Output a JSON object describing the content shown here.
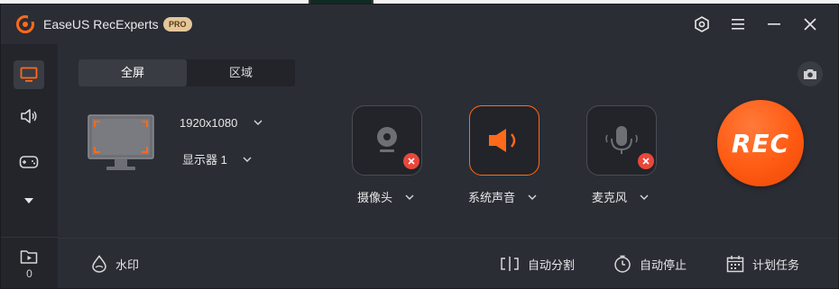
{
  "app": {
    "title": "EaseUS RecExperts",
    "badge": "PRO",
    "accent_color": "#ff6a1a",
    "rec_color": "#ff5a12"
  },
  "titlebar": {
    "buttons": [
      "settings-icon",
      "menu-icon",
      "minimize-icon",
      "close-icon"
    ]
  },
  "sidebar": {
    "items": [
      "screen-record-icon",
      "audio-record-icon",
      "game-record-icon",
      "more-dropdown-icon"
    ],
    "file_count": "0"
  },
  "capture": {
    "tabs": [
      "全屏",
      "区域"
    ],
    "active_tab": "全屏",
    "resolution": "1920x1080",
    "display": "显示器 1"
  },
  "sources": {
    "webcam": {
      "label": "摄像头",
      "enabled": false
    },
    "system_audio": {
      "label": "系统声音",
      "enabled": true
    },
    "microphone": {
      "label": "麦克风",
      "enabled": false
    }
  },
  "rec_button": {
    "label": "REC"
  },
  "bottom": {
    "watermark": "水印",
    "auto_split": "自动分割",
    "auto_stop": "自动停止",
    "schedule": "计划任务"
  }
}
